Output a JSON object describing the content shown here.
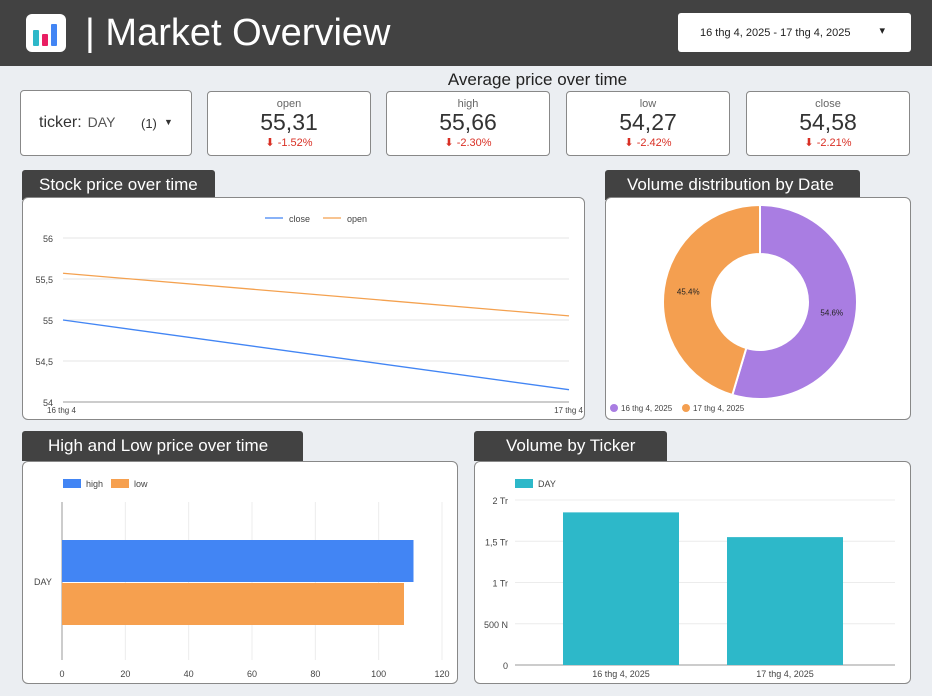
{
  "header": {
    "title": "| Market Overview",
    "date_range": "16 thg 4, 2025 - 17 thg 4, 2025"
  },
  "section_title": "Average price over time",
  "ticker_filter": {
    "label": "ticker:",
    "value": "DAY",
    "count": "(1)"
  },
  "metrics": [
    {
      "label": "open",
      "value": "55,31",
      "delta": "-1.52%"
    },
    {
      "label": "high",
      "value": "55,66",
      "delta": "-2.30%"
    },
    {
      "label": "low",
      "value": "54,27",
      "delta": "-2.42%"
    },
    {
      "label": "close",
      "value": "54,58",
      "delta": "-2.21%"
    }
  ],
  "panels": {
    "stock_price": "Stock price over time",
    "volume_dist": "Volume distribution by Date",
    "high_low": "High and Low price over time",
    "volume_ticker": "Volume by Ticker"
  },
  "colors": {
    "close": "#4285f4",
    "open": "#f4a14f",
    "high": "#4285f4",
    "low": "#f6a04f",
    "pie1": "#a97de2",
    "pie2": "#f49f50",
    "bars": "#2db8c9",
    "down": "#d93025",
    "header": "#424242"
  },
  "chart_data": [
    {
      "type": "line",
      "title": "Stock price over time",
      "x": [
        "16 thg 4",
        "17 thg 4"
      ],
      "series": [
        {
          "name": "close",
          "values": [
            55.0,
            54.15
          ]
        },
        {
          "name": "open",
          "values": [
            55.57,
            55.05
          ]
        }
      ],
      "y_ticks": [
        "54",
        "54,5",
        "55",
        "55,5",
        "56"
      ],
      "ylim": [
        54,
        56
      ],
      "legend": "top"
    },
    {
      "type": "pie",
      "title": "Volume distribution by Date",
      "slices": [
        {
          "name": "16 thg 4, 2025",
          "value": 54.6,
          "label": "54.6%"
        },
        {
          "name": "17 thg 4, 2025",
          "value": 45.4,
          "label": "45.4%"
        }
      ],
      "legend": "bottom"
    },
    {
      "type": "bar",
      "orientation": "horizontal",
      "title": "High and Low price over time",
      "categories": [
        "DAY"
      ],
      "series": [
        {
          "name": "high",
          "values": [
            111
          ]
        },
        {
          "name": "low",
          "values": [
            108
          ]
        }
      ],
      "x_ticks": [
        "0",
        "20",
        "40",
        "60",
        "80",
        "100",
        "120"
      ],
      "xlim": [
        0,
        120
      ],
      "legend": "top-left"
    },
    {
      "type": "bar",
      "title": "Volume by Ticker",
      "categories": [
        "16 thg 4, 2025",
        "17 thg 4, 2025"
      ],
      "series": [
        {
          "name": "DAY",
          "values": [
            1.85,
            1.55
          ]
        }
      ],
      "y_ticks": [
        "0",
        "500 N",
        "1 Tr",
        "1,5 Tr",
        "2 Tr"
      ],
      "ylim": [
        0,
        2
      ],
      "legend": "top-left"
    }
  ]
}
